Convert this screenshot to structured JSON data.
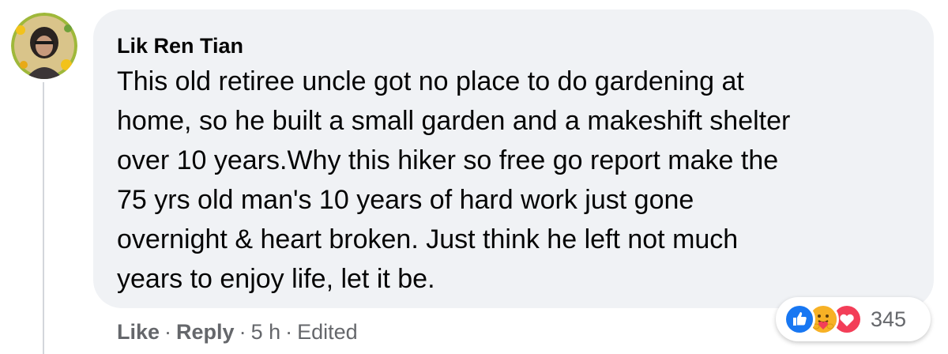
{
  "comment": {
    "author": "Lik Ren Tian",
    "text": "This old retiree uncle got no place to do gardening at\nhome, so he built a small garden and a makeshift shelter\nover 10 years.Why this hiker so free go report make the\n75 yrs old man's 10 years of hard work just gone\novernight & heart broken. Just think he left not much\nyears to enjoy life, let it be.",
    "actions": {
      "like": "Like",
      "reply": "Reply",
      "time": "5 h",
      "edited": "Edited"
    },
    "reactions": {
      "icons": [
        "like-icon",
        "care-icon",
        "love-icon"
      ],
      "count": "345"
    }
  },
  "colors": {
    "bubble": "#f0f2f5",
    "meta_text": "#65676b",
    "like_blue": "#1877f2",
    "love_red": "#f33e58",
    "care_yellow": "#f7b125"
  }
}
